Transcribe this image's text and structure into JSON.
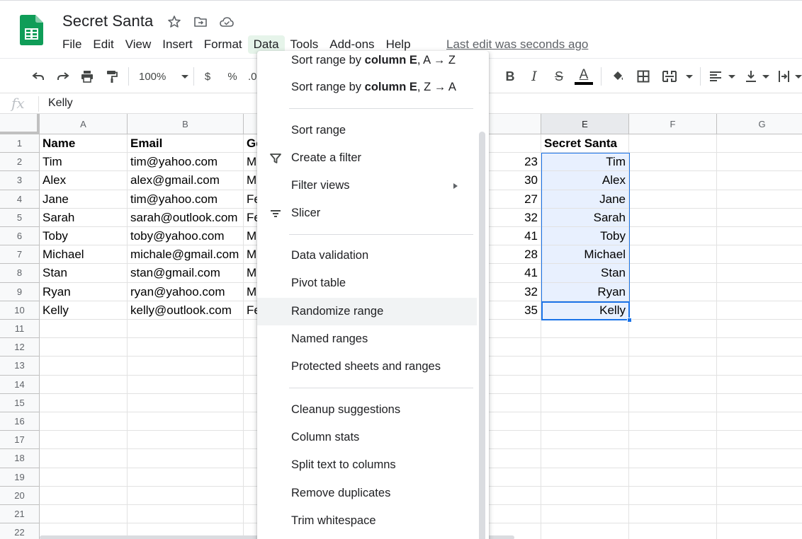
{
  "document": {
    "title": "Secret Santa",
    "last_edit": "Last edit was seconds ago"
  },
  "menubar": [
    "File",
    "Edit",
    "View",
    "Insert",
    "Format",
    "Data",
    "Tools",
    "Add-ons",
    "Help"
  ],
  "active_menu": "Data",
  "toolbar": {
    "zoom": "100%",
    "currency": "$",
    "percent": "%",
    "decimal": ".0",
    "bold": "B",
    "italic": "I",
    "strike": "S",
    "text_color": "A",
    "text_color_bar": "#000000"
  },
  "formula_bar": {
    "fx": "fx",
    "value": "Kelly"
  },
  "columns": [
    "A",
    "B",
    "",
    "",
    "",
    "E",
    "F",
    "G"
  ],
  "rows": [
    "1",
    "2",
    "3",
    "4",
    "5",
    "6",
    "7",
    "8",
    "9",
    "10",
    "11",
    "12",
    "13",
    "14",
    "15",
    "16",
    "17",
    "18",
    "19",
    "20",
    "21",
    "22"
  ],
  "table": {
    "headers": {
      "a": "Name",
      "b": "Email",
      "c": "Ge",
      "e": "Secret Santa"
    },
    "rows": [
      {
        "name": "Tim",
        "email": "tim@yahoo.com",
        "gender": "M",
        "age": "23",
        "santa": "Tim"
      },
      {
        "name": "Alex",
        "email": "alex@gmail.com",
        "gender": "M",
        "age": "30",
        "santa": "Alex"
      },
      {
        "name": "Jane",
        "email": "tim@yahoo.com",
        "gender": "Fe",
        "age": "27",
        "santa": "Jane"
      },
      {
        "name": "Sarah",
        "email": "sarah@outlook.com",
        "gender": "Fe",
        "age": "32",
        "santa": "Sarah"
      },
      {
        "name": "Toby",
        "email": "toby@yahoo.com",
        "gender": "M",
        "age": "41",
        "santa": "Toby"
      },
      {
        "name": "Michael",
        "email": "michale@gmail.com",
        "gender": "M",
        "age": "28",
        "santa": "Michael"
      },
      {
        "name": "Stan",
        "email": "stan@gmail.com",
        "gender": "M",
        "age": "41",
        "santa": "Stan"
      },
      {
        "name": "Ryan",
        "email": "ryan@yahoo.com",
        "gender": "M",
        "age": "32",
        "santa": "Ryan"
      },
      {
        "name": "Kelly",
        "email": "kelly@outlook.com",
        "gender": "Fe",
        "age": "35",
        "santa": "Kelly"
      }
    ]
  },
  "data_menu": {
    "sort_az": {
      "pre": "Sort range by ",
      "bold": "column E",
      "post": ", A → Z"
    },
    "sort_za": {
      "pre": "Sort range by ",
      "bold": "column E",
      "post": ", Z → A"
    },
    "items": [
      "Sort range",
      "Create a filter",
      "Filter views",
      "Slicer",
      "Data validation",
      "Pivot table",
      "Randomize range",
      "Named ranges",
      "Protected sheets and ranges",
      "Cleanup suggestions",
      "Column stats",
      "Split text to columns",
      "Remove duplicates",
      "Trim whitespace"
    ],
    "hovered": "Randomize range"
  },
  "colors": {
    "sheets_green": "#0f9d58",
    "selection_blue": "#1a73e8",
    "selection_fill": "#e8f0fe",
    "active_menu_bg": "#e6f4ea"
  }
}
